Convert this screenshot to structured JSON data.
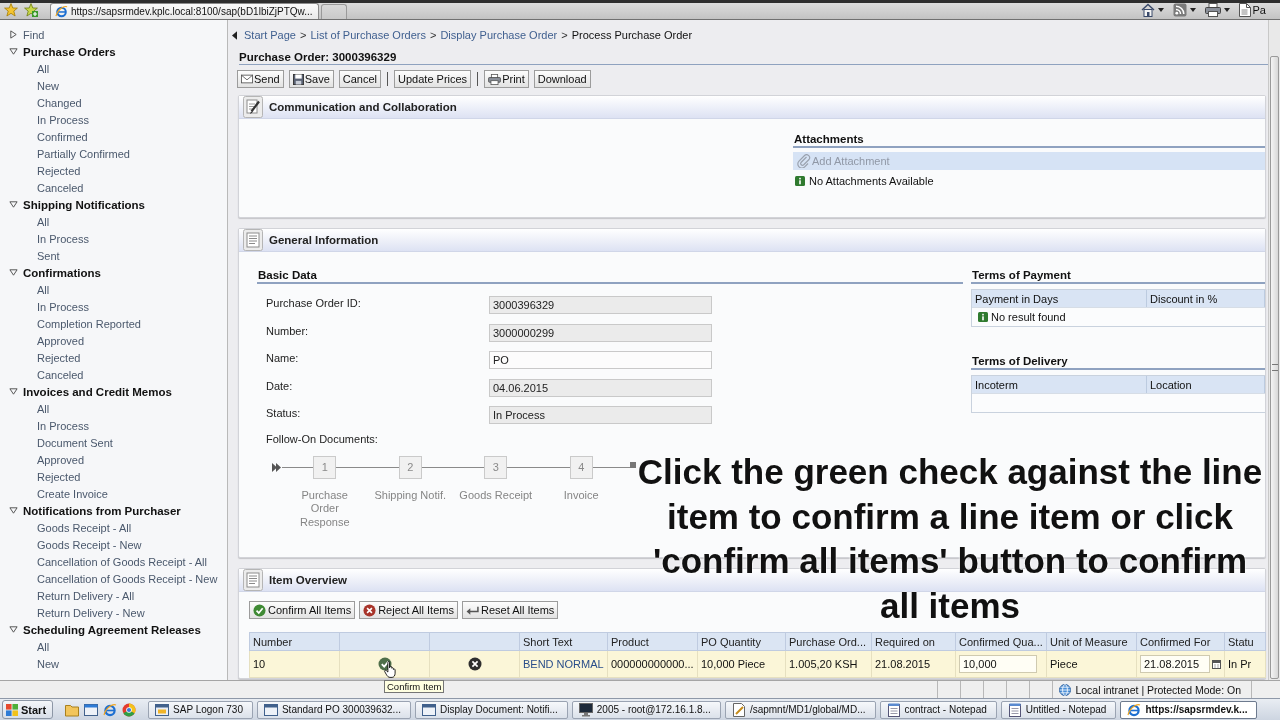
{
  "browser": {
    "url": "https://sapsrmdev.kplc.local:8100/sap(bD1lbiZjPTQw...",
    "command_cut_label": "Pa"
  },
  "sidebar": {
    "groups": [
      {
        "title": "Find",
        "expanded": false
      },
      {
        "title": "Purchase Orders",
        "expanded": true,
        "items": [
          "All",
          "New",
          "Changed",
          "In Process",
          "Confirmed",
          "Partially Confirmed",
          "Rejected",
          "Canceled"
        ]
      },
      {
        "title": "Shipping Notifications",
        "expanded": true,
        "items": [
          "All",
          "In Process",
          "Sent"
        ]
      },
      {
        "title": "Confirmations",
        "expanded": true,
        "items": [
          "All",
          "In Process",
          "Completion Reported",
          "Approved",
          "Rejected",
          "Canceled"
        ]
      },
      {
        "title": "Invoices and Credit Memos",
        "expanded": true,
        "items": [
          "All",
          "In Process",
          "Document Sent",
          "Approved",
          "Rejected",
          "Create Invoice"
        ]
      },
      {
        "title": "Notifications from Purchaser",
        "expanded": true,
        "items": [
          "Goods Receipt - All",
          "Goods Receipt - New",
          "Cancellation of Goods Receipt - All",
          "Cancellation of Goods Receipt - New",
          "Return Delivery - All",
          "Return Delivery - New"
        ]
      },
      {
        "title": "Scheduling Agreement Releases",
        "expanded": true,
        "items": [
          "All",
          "New"
        ]
      }
    ]
  },
  "breadcrumb": {
    "items": [
      {
        "label": "Start Page",
        "current": false,
        "separator": ">"
      },
      {
        "label": "List of Purchase Orders",
        "current": false,
        "separator": ">"
      },
      {
        "label": "Display Purchase Order",
        "current": false,
        "separator": ">"
      },
      {
        "label": "Process Purchase Order",
        "current": true
      }
    ]
  },
  "title": "Purchase Order: 3000396329",
  "toolbar": [
    {
      "buttons": [
        {
          "label": "Send",
          "kind": "send"
        },
        {
          "label": "Save",
          "kind": "save"
        },
        {
          "label": "Cancel",
          "kind": "plain"
        }
      ]
    },
    {
      "buttons": [
        {
          "label": "Update Prices",
          "kind": "plain"
        }
      ]
    },
    {
      "buttons": [
        {
          "label": "Print",
          "kind": "print"
        },
        {
          "label": "Download",
          "kind": "plain"
        }
      ]
    }
  ],
  "communication": {
    "title": "Communication and Collaboration",
    "attachments": {
      "title": "Attachments",
      "add_button": {
        "label": "Add Attachment",
        "disabled": true
      },
      "message": "No Attachments Available"
    }
  },
  "general_information": {
    "title": "General Information",
    "basic_data": {
      "title": "Basic Data",
      "fields": [
        {
          "label": "Purchase Order ID:",
          "value": "3000396329",
          "disabled": true
        },
        {
          "label": "Number:",
          "value": "3000000299",
          "disabled": true
        },
        {
          "label": "Name:",
          "value": "PO",
          "disabled": false
        },
        {
          "label": "Date:",
          "value": "04.06.2015",
          "disabled": true
        },
        {
          "label": "Status:",
          "value": "In Process",
          "disabled": true
        }
      ],
      "follow_on": {
        "label": "Follow-On Documents:",
        "steps": [
          {
            "number": "1",
            "label": "Purchase Order Response"
          },
          {
            "number": "2",
            "label": "Shipping Notif."
          },
          {
            "number": "3",
            "label": "Goods Receipt"
          },
          {
            "number": "4",
            "label": "Invoice"
          }
        ]
      }
    },
    "terms_of_payment": {
      "title": "Terms of Payment",
      "columns": [
        "Payment in Days",
        "Discount in %"
      ],
      "message": "No result found"
    },
    "terms_of_delivery": {
      "title": "Terms of Delivery",
      "columns": [
        "Incoterm",
        "Location"
      ]
    }
  },
  "item_overview": {
    "title": "Item Overview",
    "buttons": [
      {
        "label": "Confirm All Items",
        "kind": "confirm"
      },
      {
        "label": "Reject All Items",
        "kind": "reject"
      },
      {
        "label": "Reset All Items",
        "kind": "reset"
      }
    ],
    "columns": [
      {
        "kind": "text",
        "label": "Number"
      },
      {
        "kind": "icon"
      },
      {
        "kind": "icon"
      },
      {
        "kind": "text",
        "label": "Short Text"
      },
      {
        "kind": "text",
        "label": "Product"
      },
      {
        "kind": "text",
        "label": "PO Quantity"
      },
      {
        "kind": "text",
        "label": "Purchase Ord..."
      },
      {
        "kind": "text",
        "label": "Required on"
      },
      {
        "kind": "text",
        "label": "Confirmed Qua..."
      },
      {
        "kind": "text",
        "label": "Unit of Measure"
      },
      {
        "kind": "text",
        "label": "Confirmed For"
      },
      {
        "kind": "text",
        "label": "Statu"
      }
    ],
    "rows": [
      {
        "selected": true,
        "cells": [
          {
            "kind": "text",
            "text": "10"
          },
          {
            "kind": "confirm"
          },
          {
            "kind": "reject"
          },
          {
            "kind": "link",
            "text": "BEND NORMAL"
          },
          {
            "kind": "text",
            "text": "000000000000..."
          },
          {
            "kind": "text",
            "text": "10,000 Piece"
          },
          {
            "kind": "text",
            "text": "1.005,20 KSH"
          },
          {
            "kind": "text",
            "text": "21.08.2015"
          },
          {
            "kind": "input",
            "text": "10,000"
          },
          {
            "kind": "text",
            "text": "Piece"
          },
          {
            "kind": "date_input",
            "text": "21.08.2015"
          },
          {
            "kind": "text",
            "text": "In Pr"
          }
        ]
      }
    ]
  },
  "tooltip": {
    "text": "Confirm Item"
  },
  "caption": {
    "text": "Click the green check against the line item to confirm a line item or click 'confirm all items' button to confirm all items"
  },
  "status_bar": {
    "zone": "Local intranet | Protected Mode: On"
  },
  "taskbar": {
    "start": "Start",
    "tasks": [
      {
        "label": "SAP Logon 730",
        "kind": "sap",
        "selected": false
      },
      {
        "label": "Standard PO 300039632...",
        "kind": "window",
        "selected": false
      },
      {
        "label": "Display Document: Notifi...",
        "kind": "window",
        "selected": false
      },
      {
        "label": "2005 - root@172.16.1.8...",
        "kind": "terminal",
        "selected": false
      },
      {
        "label": "/sapmnt/MD1/global/MD...",
        "kind": "editor",
        "selected": false
      },
      {
        "label": "contract - Notepad",
        "kind": "notepad",
        "selected": false
      },
      {
        "label": "Untitled - Notepad",
        "kind": "notepad",
        "selected": false
      },
      {
        "label": "https://sapsrmdev.k...",
        "kind": "browser",
        "selected": true
      }
    ]
  }
}
